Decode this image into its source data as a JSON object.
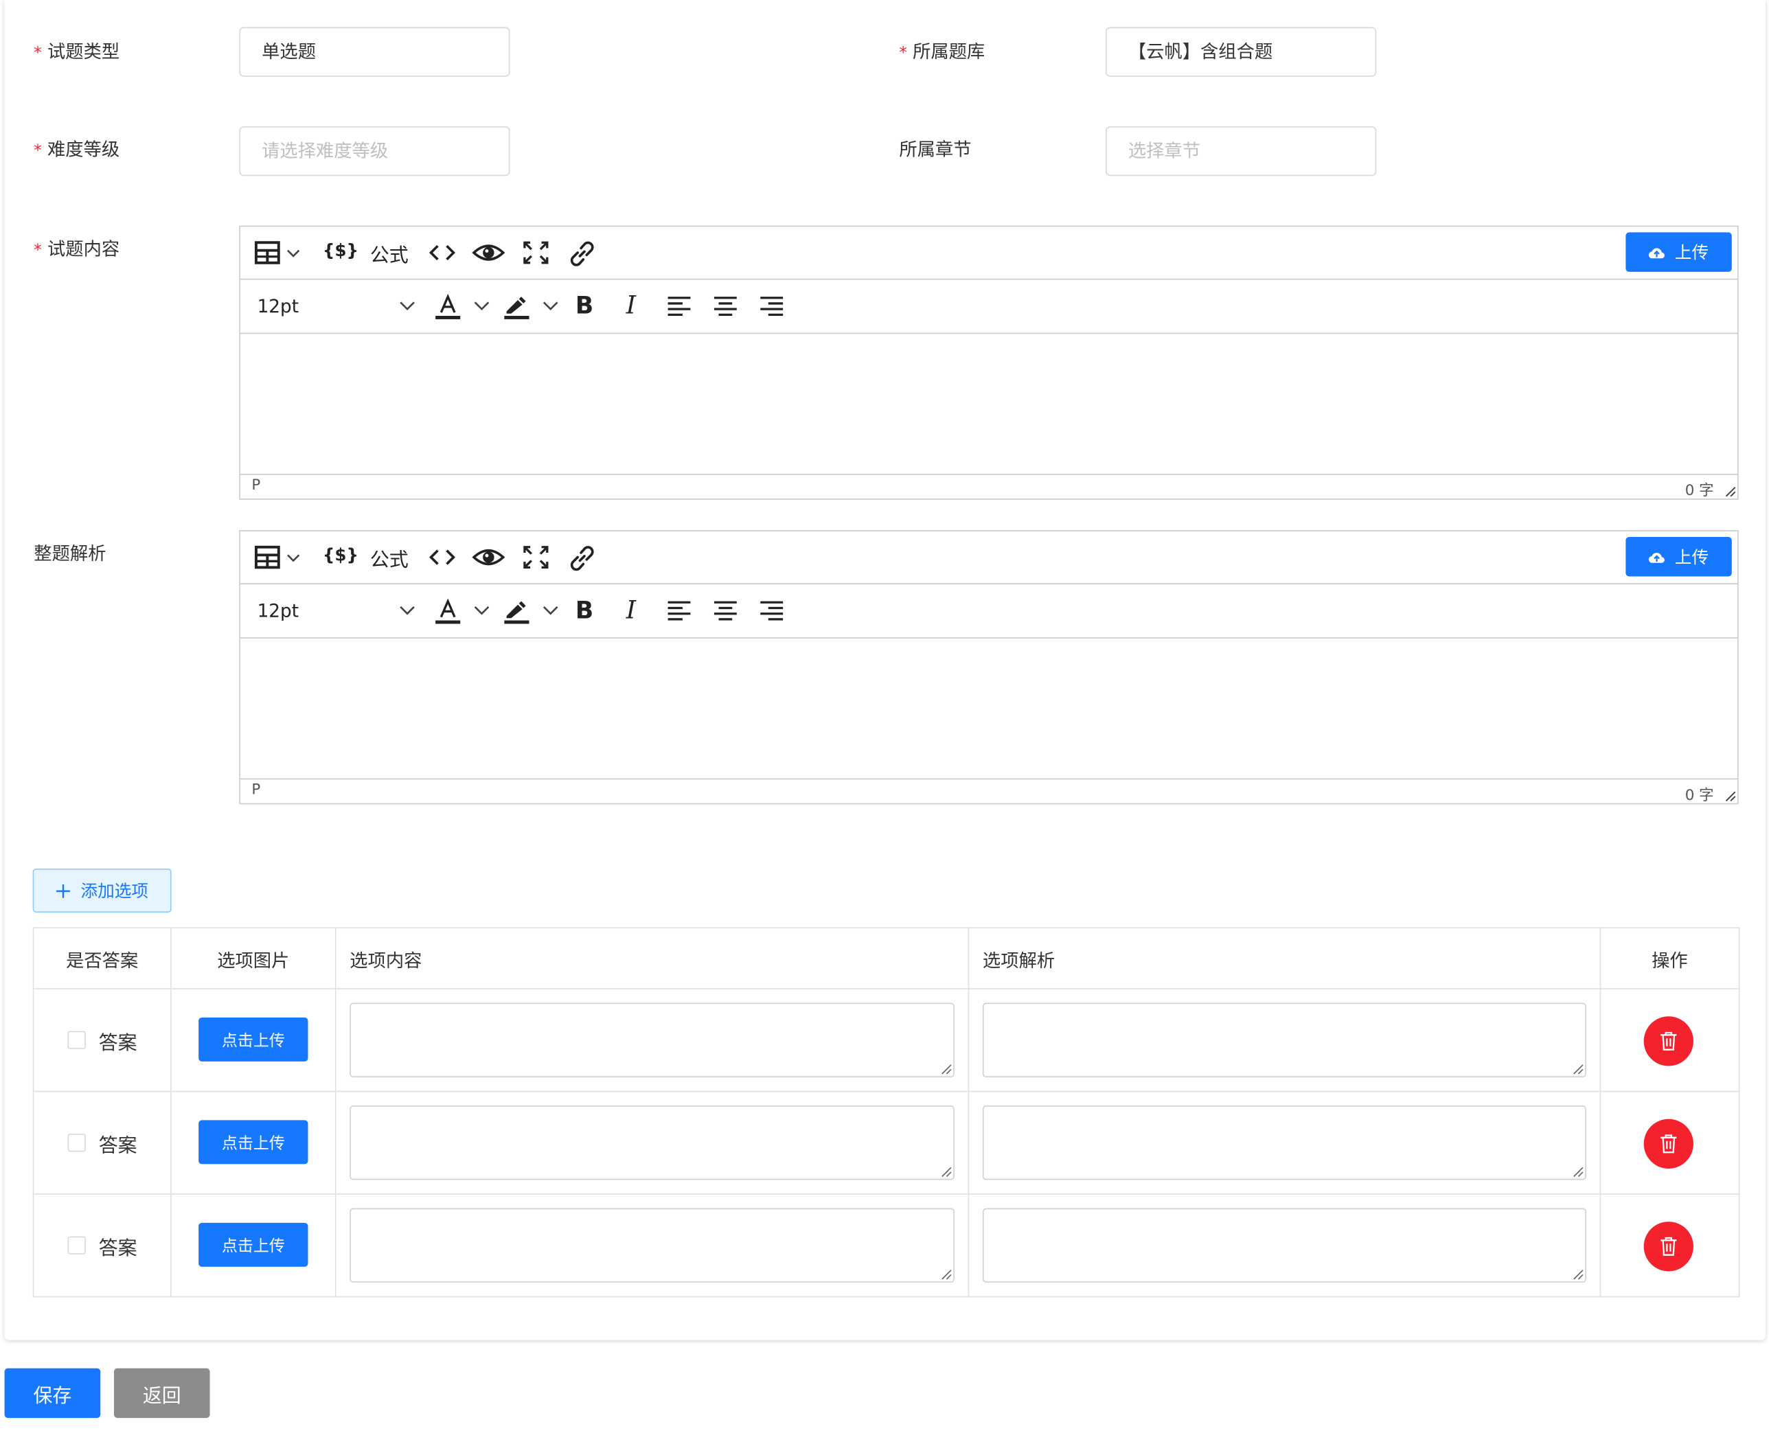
{
  "form": {
    "type_label": "试题类型",
    "type_value": "单选题",
    "bank_label": "所属题库",
    "bank_value": "【云帆】含组合题",
    "difficulty_label": "难度等级",
    "difficulty_placeholder": "请选择难度等级",
    "chapter_label": "所属章节",
    "chapter_placeholder": "选择章节",
    "content_label": "试题内容",
    "analysis_label": "整题解析",
    "required_mark": "*"
  },
  "editor": {
    "formula_label": "公式",
    "upload_label": "上传",
    "font_size": "12pt",
    "path_label": "P",
    "word_count": "0 字"
  },
  "options": {
    "add_label": "添加选项",
    "headers": [
      "是否答案",
      "选项图片",
      "选项内容",
      "选项解析",
      "操作"
    ],
    "answer_label": "答案",
    "upload_button": "点击上传"
  },
  "actions": {
    "save": "保存",
    "back": "返回"
  },
  "colors": {
    "primary": "#1677ff",
    "danger": "#f5222d",
    "secondary": "#8c8c8c"
  }
}
